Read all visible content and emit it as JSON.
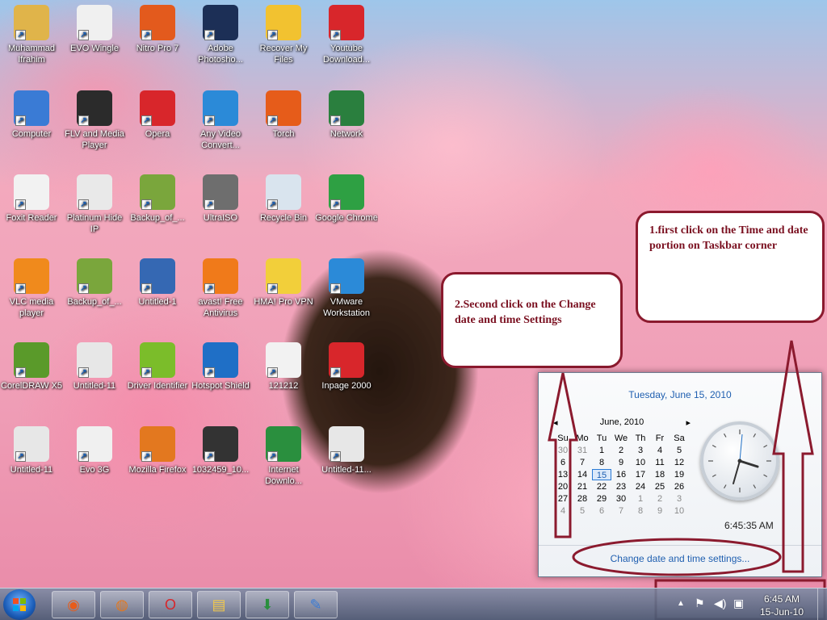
{
  "desktop_icons": [
    {
      "label": "Muhammad Ifrahim",
      "icon": "user-folder-icon",
      "color": "#e0b44a"
    },
    {
      "label": "EVO Wingle",
      "icon": "evo-icon",
      "color": "#f0f0f0"
    },
    {
      "label": "Nitro Pro 7",
      "icon": "nitro-icon",
      "color": "#e35a1d"
    },
    {
      "label": "Adobe Photosho...",
      "icon": "photoshop-icon",
      "color": "#1c2f56"
    },
    {
      "label": "Recover My Files",
      "icon": "recover-icon",
      "color": "#f2c230"
    },
    {
      "label": "Youtube Download...",
      "icon": "youtube-icon",
      "color": "#d8262b"
    },
    {
      "label": "Computer",
      "icon": "computer-icon",
      "color": "#3a7bd5"
    },
    {
      "label": "FLV and Media Player",
      "icon": "flv-icon",
      "color": "#2b2b2b"
    },
    {
      "label": "Opera",
      "icon": "opera-icon",
      "color": "#d8262b"
    },
    {
      "label": "Any Video Convert...",
      "icon": "video-convert-icon",
      "color": "#2b8ad8"
    },
    {
      "label": "Torch",
      "icon": "torch-icon",
      "color": "#e65c1a"
    },
    {
      "label": "Network",
      "icon": "network-icon",
      "color": "#2a7f3e"
    },
    {
      "label": "Foxit Reader",
      "icon": "foxit-icon",
      "color": "#f2f2f2"
    },
    {
      "label": "Platinum Hide IP",
      "icon": "hide-ip-icon",
      "color": "#e9e9e9"
    },
    {
      "label": "Backup_of_...",
      "icon": "backup-icon",
      "color": "#7aa63c"
    },
    {
      "label": "UltraISO",
      "icon": "ultraiso-icon",
      "color": "#6e6e6e"
    },
    {
      "label": "Recycle Bin",
      "icon": "recycle-bin-icon",
      "color": "#d9e4ee"
    },
    {
      "label": "Google Chrome",
      "icon": "chrome-icon",
      "color": "#2ea043"
    },
    {
      "label": "VLC media player",
      "icon": "vlc-icon",
      "color": "#f08a1c"
    },
    {
      "label": "Backup_of_...",
      "icon": "backup-icon",
      "color": "#7aa63c"
    },
    {
      "label": "Untitled-1",
      "icon": "windows7-icon",
      "color": "#3568b3"
    },
    {
      "label": "avast! Free Antivirus",
      "icon": "avast-icon",
      "color": "#f07a1a"
    },
    {
      "label": "HMA! Pro VPN",
      "icon": "hma-icon",
      "color": "#f2cf3a"
    },
    {
      "label": "VMware Workstation",
      "icon": "vmware-icon",
      "color": "#2b8ad8"
    },
    {
      "label": "CorelDRAW X5",
      "icon": "coreldraw-icon",
      "color": "#5a9a2a"
    },
    {
      "label": "Untitled-11",
      "icon": "image-icon",
      "color": "#e7e7e7"
    },
    {
      "label": "Driver Identifier",
      "icon": "driver-icon",
      "color": "#7bbd2a"
    },
    {
      "label": "Hotspot Shield",
      "icon": "hotspot-icon",
      "color": "#1f6fc6"
    },
    {
      "label": "121212",
      "icon": "word-doc-icon",
      "color": "#f2f2f2"
    },
    {
      "label": "Inpage 2000",
      "icon": "inpage-icon",
      "color": "#d8262b"
    },
    {
      "label": "Untitled-11",
      "icon": "image-icon",
      "color": "#e7e7e7"
    },
    {
      "label": "Evo 3G",
      "icon": "evo-icon",
      "color": "#f0f0f0"
    },
    {
      "label": "Mozilla Firefox",
      "icon": "firefox-icon",
      "color": "#e3781f"
    },
    {
      "label": "1032459_10...",
      "icon": "video-thumb-icon",
      "color": "#333333"
    },
    {
      "label": "Internet Downlo...",
      "icon": "idm-icon",
      "color": "#2a8f3e"
    },
    {
      "label": "Untitled-11...",
      "icon": "image-icon",
      "color": "#e7e7e7"
    }
  ],
  "callouts": {
    "first": "1.first click on the Time and date portion on Taskbar corner",
    "second": "2.Second click on the Change date and time Settings"
  },
  "calendar_popup": {
    "long_date": "Tuesday, June 15, 2010",
    "month_label": "June, 2010",
    "weekdays": [
      "Su",
      "Mo",
      "Tu",
      "We",
      "Th",
      "Fr",
      "Sa"
    ],
    "days": [
      [
        "30",
        "31",
        "1",
        "2",
        "3",
        "4",
        "5"
      ],
      [
        "6",
        "7",
        "8",
        "9",
        "10",
        "11",
        "12"
      ],
      [
        "13",
        "14",
        "15",
        "16",
        "17",
        "18",
        "19"
      ],
      [
        "20",
        "21",
        "22",
        "23",
        "24",
        "25",
        "26"
      ],
      [
        "27",
        "28",
        "29",
        "30",
        "1",
        "2",
        "3"
      ],
      [
        "4",
        "5",
        "6",
        "7",
        "8",
        "9",
        "10"
      ]
    ],
    "today": "15",
    "long_time": "6:45:35 AM",
    "change_link": "Change date and time settings..."
  },
  "taskbar": {
    "pinned": [
      {
        "icon": "torch-icon",
        "glyph": "◉",
        "color": "#e65c1a"
      },
      {
        "icon": "firefox-icon",
        "glyph": "◍",
        "color": "#e3781f"
      },
      {
        "icon": "opera-icon",
        "glyph": "O",
        "color": "#d8262b"
      },
      {
        "icon": "explorer-icon",
        "glyph": "▤",
        "color": "#f2c84a"
      },
      {
        "icon": "idm-icon",
        "glyph": "⬇",
        "color": "#2a8f3e"
      },
      {
        "icon": "paint-icon",
        "glyph": "✎",
        "color": "#3a7bd5"
      }
    ],
    "clock_time": "6:45 AM",
    "clock_date": "15-Jun-10"
  },
  "colors": {
    "callout_border": "#8b1a2e",
    "link": "#1f5fb0"
  }
}
